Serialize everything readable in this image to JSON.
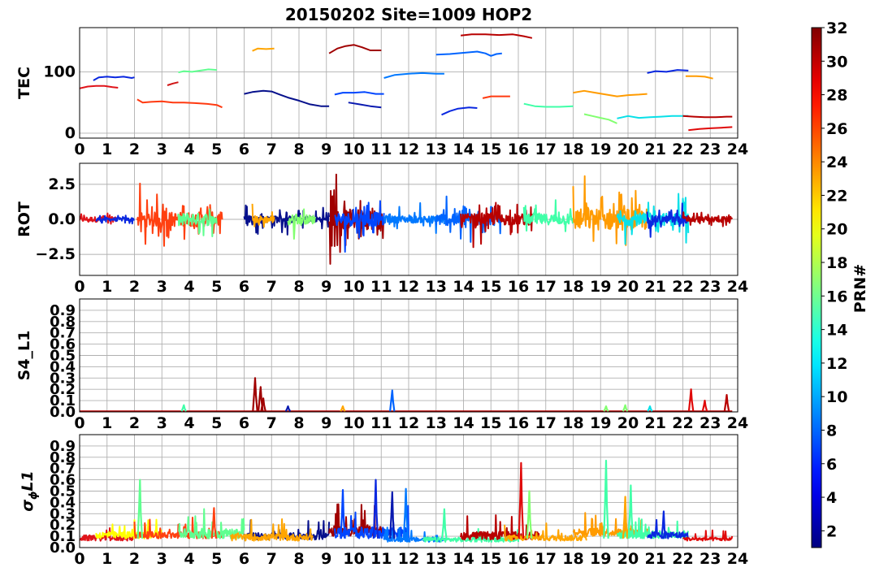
{
  "title": "20150202 Site=1009 HOP2",
  "colorbar": {
    "label": "PRN#",
    "range": [
      1,
      32
    ],
    "ticks": [
      "2",
      "4",
      "6",
      "8",
      "10",
      "12",
      "14",
      "16",
      "18",
      "20",
      "22",
      "24",
      "26",
      "28",
      "30",
      "32"
    ],
    "colormap": "jet"
  },
  "chart_data": [
    {
      "type": "line",
      "ylabel": "TEC",
      "xlim": [
        0,
        24
      ],
      "ylim": [
        -8,
        172
      ],
      "yticks": [
        0,
        100
      ],
      "ytick_labels": [
        "0",
        "100"
      ],
      "xtick_labels": [
        "0",
        "1",
        "2",
        "3",
        "4",
        "5",
        "6",
        "7",
        "8",
        "9",
        "10",
        "11",
        "12",
        "13",
        "14",
        "15",
        "16",
        "17",
        "18",
        "19",
        "20",
        "21",
        "22",
        "23",
        "24"
      ],
      "grid": true,
      "series": [
        {
          "prn": 28,
          "color": "#e0141a",
          "x": [
            0.0,
            0.3,
            0.6,
            0.9,
            1.2,
            1.4
          ],
          "y": [
            73,
            76,
            77,
            77,
            75,
            74
          ]
        },
        {
          "prn": 5,
          "color": "#0a28e0",
          "x": [
            0.5,
            0.7,
            1.0,
            1.3,
            1.6,
            1.9,
            2.0
          ],
          "y": [
            86,
            91,
            92,
            91,
            92,
            90,
            91
          ]
        },
        {
          "prn": 27,
          "color": "#ff3a10",
          "x": [
            2.1,
            2.3,
            2.6,
            3.0,
            3.4,
            3.8,
            4.2,
            4.6,
            5.0,
            5.2
          ],
          "y": [
            55,
            50,
            51,
            52,
            50,
            50,
            49,
            48,
            46,
            42
          ]
        },
        {
          "prn": 29,
          "color": "#d01414",
          "x": [
            3.2,
            3.4,
            3.6
          ],
          "y": [
            78,
            81,
            83
          ]
        },
        {
          "prn": 15,
          "color": "#60ff90",
          "x": [
            3.6,
            3.8,
            4.1,
            4.4,
            4.7,
            5.0
          ],
          "y": [
            99,
            101,
            100,
            102,
            104,
            103
          ]
        },
        {
          "prn": 23,
          "color": "#ffa500",
          "x": [
            6.3,
            6.5,
            6.8,
            7.1
          ],
          "y": [
            134,
            138,
            137,
            138
          ]
        },
        {
          "prn": 2,
          "color": "#06108c",
          "x": [
            6.0,
            6.3,
            6.7,
            7.0,
            7.3,
            7.6,
            8.0,
            8.4,
            8.8,
            9.1
          ],
          "y": [
            64,
            67,
            69,
            68,
            63,
            58,
            53,
            47,
            44,
            44
          ]
        },
        {
          "prn": 32,
          "color": "#a00000",
          "x": [
            9.1,
            9.4,
            9.7,
            10.0,
            10.3,
            10.6,
            11.0
          ],
          "y": [
            130,
            138,
            142,
            144,
            140,
            135,
            135
          ]
        },
        {
          "prn": 9,
          "color": "#0078ff",
          "x": [
            11.1,
            11.5,
            12.0,
            12.5,
            13.0,
            13.3
          ],
          "y": [
            90,
            95,
            97,
            98,
            97,
            97
          ]
        },
        {
          "prn": 8,
          "color": "#0064ff",
          "x": [
            13.0,
            13.5,
            14.0,
            14.5,
            14.8,
            15.0,
            15.2,
            15.4
          ],
          "y": [
            128,
            129,
            131,
            133,
            130,
            126,
            129,
            130
          ]
        },
        {
          "prn": 31,
          "color": "#b80000",
          "x": [
            13.9,
            14.3,
            14.8,
            15.3,
            15.8,
            16.2,
            16.5
          ],
          "y": [
            159,
            161,
            161,
            160,
            161,
            158,
            155
          ]
        },
        {
          "prn": 6,
          "color": "#0046ff",
          "x": [
            9.3,
            9.6,
            10.0,
            10.4,
            10.8,
            11.1
          ],
          "y": [
            63,
            66,
            66,
            67,
            64,
            64
          ]
        },
        {
          "prn": 3,
          "color": "#0a1ab0",
          "x": [
            9.8,
            10.2,
            10.6,
            11.0
          ],
          "y": [
            50,
            47,
            44,
            42
          ]
        },
        {
          "prn": 5,
          "color": "#0a28e0",
          "x": [
            13.2,
            13.5,
            13.8,
            14.2,
            14.5
          ],
          "y": [
            30,
            36,
            40,
            42,
            41
          ]
        },
        {
          "prn": 27,
          "color": "#ff3a10",
          "x": [
            14.7,
            15.0,
            15.3,
            15.7
          ],
          "y": [
            57,
            60,
            60,
            60
          ]
        },
        {
          "prn": 14,
          "color": "#40ffa8",
          "x": [
            16.2,
            16.6,
            17.0,
            17.5,
            18.0
          ],
          "y": [
            48,
            44,
            43,
            43,
            44
          ]
        },
        {
          "prn": 24,
          "color": "#ff9b00",
          "x": [
            18.0,
            18.4,
            18.8,
            19.2,
            19.6,
            20.0,
            20.4,
            20.7
          ],
          "y": [
            66,
            69,
            66,
            63,
            60,
            62,
            63,
            64
          ]
        },
        {
          "prn": 16,
          "color": "#82ff70",
          "x": [
            18.4,
            18.7,
            19.0,
            19.3,
            19.6
          ],
          "y": [
            31,
            28,
            25,
            22,
            16
          ]
        },
        {
          "prn": 12,
          "color": "#08e0e8",
          "x": [
            19.6,
            20.0,
            20.4,
            20.8,
            21.2,
            21.6,
            22.2
          ],
          "y": [
            24,
            28,
            25,
            26,
            27,
            28,
            28
          ]
        },
        {
          "prn": 5,
          "color": "#0a28e0",
          "x": [
            20.7,
            21.0,
            21.4,
            21.8,
            22.2
          ],
          "y": [
            98,
            101,
            100,
            103,
            102
          ]
        },
        {
          "prn": 24,
          "color": "#ff9b00",
          "x": [
            22.1,
            22.5,
            22.8,
            23.1
          ],
          "y": [
            93,
            93,
            92,
            89
          ]
        },
        {
          "prn": 31,
          "color": "#b80000",
          "x": [
            22.0,
            22.4,
            22.8,
            23.2,
            23.6,
            23.8
          ],
          "y": [
            28,
            27,
            26,
            26,
            27,
            27
          ]
        },
        {
          "prn": 30,
          "color": "#e00a0a",
          "x": [
            22.2,
            22.6,
            23.0,
            23.4,
            23.8
          ],
          "y": [
            5,
            7,
            8,
            9,
            10
          ]
        }
      ]
    },
    {
      "type": "line",
      "ylabel": "ROT",
      "xlim": [
        0,
        24
      ],
      "ylim": [
        -4.0,
        4.0
      ],
      "yticks": [
        -2.5,
        0.0,
        2.5
      ],
      "ytick_labels": [
        "−2.5",
        "0.0",
        "2.5"
      ],
      "xtick_labels": [
        "0",
        "1",
        "2",
        "3",
        "4",
        "5",
        "6",
        "7",
        "8",
        "9",
        "10",
        "11",
        "12",
        "13",
        "14",
        "15",
        "16",
        "17",
        "18",
        "19",
        "20",
        "21",
        "22",
        "23",
        "24"
      ],
      "grid": true,
      "noise_segments": [
        {
          "start": 0.0,
          "end": 1.4,
          "color": "#e0141a",
          "amp": 0.9
        },
        {
          "start": 0.6,
          "end": 2.0,
          "color": "#0a28e0",
          "amp": 0.6
        },
        {
          "start": 2.1,
          "end": 5.2,
          "color": "#ff4010",
          "amp": 2.6
        },
        {
          "start": 3.6,
          "end": 5.0,
          "color": "#60ff90",
          "amp": 2.2
        },
        {
          "start": 6.0,
          "end": 9.1,
          "color": "#06108c",
          "amp": 1.2
        },
        {
          "start": 6.3,
          "end": 7.1,
          "color": "#ffa500",
          "amp": 1.3
        },
        {
          "start": 7.6,
          "end": 8.6,
          "color": "#82ff70",
          "amp": 1.6
        },
        {
          "start": 9.1,
          "end": 11.1,
          "color": "#a00000",
          "amp": 3.6
        },
        {
          "start": 9.3,
          "end": 11.1,
          "color": "#0046ff",
          "amp": 2.4
        },
        {
          "start": 11.1,
          "end": 13.3,
          "color": "#0078ff",
          "amp": 1.2
        },
        {
          "start": 13.0,
          "end": 15.4,
          "color": "#0064ff",
          "amp": 2.2
        },
        {
          "start": 13.9,
          "end": 16.5,
          "color": "#b80000",
          "amp": 2.0
        },
        {
          "start": 16.2,
          "end": 18.0,
          "color": "#40ffa8",
          "amp": 1.9
        },
        {
          "start": 18.0,
          "end": 20.7,
          "color": "#ff9b00",
          "amp": 3.8
        },
        {
          "start": 19.6,
          "end": 22.2,
          "color": "#08e0e8",
          "amp": 2.2
        },
        {
          "start": 20.7,
          "end": 22.2,
          "color": "#0a28e0",
          "amp": 1.3
        },
        {
          "start": 22.0,
          "end": 23.8,
          "color": "#b80000",
          "amp": 1.0
        }
      ]
    },
    {
      "type": "line",
      "ylabel": "S4_L1",
      "xlim": [
        0,
        24
      ],
      "ylim": [
        0.0,
        1.0
      ],
      "yticks": [
        0.0,
        0.1,
        0.2,
        0.3,
        0.4,
        0.5,
        0.6,
        0.7,
        0.8,
        0.9
      ],
      "ytick_labels": [
        "0.0",
        "0.1",
        "0.2",
        "0.3",
        "0.4",
        "0.5",
        "0.6",
        "0.7",
        "0.8",
        "0.9"
      ],
      "xtick_labels": [
        "0",
        "1",
        "2",
        "3",
        "4",
        "5",
        "6",
        "7",
        "8",
        "9",
        "10",
        "11",
        "12",
        "13",
        "14",
        "15",
        "16",
        "17",
        "18",
        "19",
        "20",
        "21",
        "22",
        "23",
        "24"
      ],
      "grid": true,
      "baseline_color": "#b80000",
      "spikes": [
        {
          "x": 6.4,
          "peak": 0.3,
          "color": "#a00000"
        },
        {
          "x": 6.6,
          "peak": 0.22,
          "color": "#a00000"
        },
        {
          "x": 6.7,
          "peak": 0.12,
          "color": "#a00000"
        },
        {
          "x": 3.8,
          "peak": 0.06,
          "color": "#40ffa8"
        },
        {
          "x": 7.6,
          "peak": 0.05,
          "color": "#0a1ab0"
        },
        {
          "x": 9.6,
          "peak": 0.05,
          "color": "#ffa500"
        },
        {
          "x": 11.4,
          "peak": 0.19,
          "color": "#0064ff"
        },
        {
          "x": 19.2,
          "peak": 0.05,
          "color": "#82ff70"
        },
        {
          "x": 19.9,
          "peak": 0.06,
          "color": "#82ff70"
        },
        {
          "x": 20.8,
          "peak": 0.05,
          "color": "#08e0e8"
        },
        {
          "x": 22.3,
          "peak": 0.2,
          "color": "#e00a0a"
        },
        {
          "x": 22.8,
          "peak": 0.1,
          "color": "#e00a0a"
        },
        {
          "x": 23.6,
          "peak": 0.15,
          "color": "#b80000"
        }
      ]
    },
    {
      "type": "line",
      "ylabel": "σφL1",
      "ylabel_base": "σ",
      "ylabel_sub": "ϕ",
      "ylabel_rest": "L1",
      "xlim": [
        0,
        24
      ],
      "ylim": [
        0.0,
        1.0
      ],
      "yticks": [
        0.0,
        0.1,
        0.2,
        0.3,
        0.4,
        0.5,
        0.6,
        0.7,
        0.8,
        0.9
      ],
      "ytick_labels": [
        "0.0",
        "0.1",
        "0.2",
        "0.3",
        "0.4",
        "0.5",
        "0.6",
        "0.7",
        "0.8",
        "0.9"
      ],
      "xtick_labels": [
        "0",
        "1",
        "2",
        "3",
        "4",
        "5",
        "6",
        "7",
        "8",
        "9",
        "10",
        "11",
        "12",
        "13",
        "14",
        "15",
        "16",
        "17",
        "18",
        "19",
        "20",
        "21",
        "22",
        "23",
        "24"
      ],
      "grid": true,
      "noise_segments": [
        {
          "start": 0.0,
          "end": 2.0,
          "color": "#e0141a",
          "base": 0.06,
          "amp": 0.1
        },
        {
          "start": 0.6,
          "end": 3.0,
          "color": "#ffff00",
          "base": 0.08,
          "amp": 0.12
        },
        {
          "start": 2.0,
          "end": 5.2,
          "color": "#ff4010",
          "base": 0.08,
          "amp": 0.12
        },
        {
          "start": 3.6,
          "end": 6.0,
          "color": "#60ff90",
          "base": 0.08,
          "amp": 0.18
        },
        {
          "start": 6.0,
          "end": 9.1,
          "color": "#06108c",
          "base": 0.07,
          "amp": 0.12
        },
        {
          "start": 5.5,
          "end": 8.5,
          "color": "#ffa500",
          "base": 0.06,
          "amp": 0.12
        },
        {
          "start": 9.1,
          "end": 11.1,
          "color": "#a00000",
          "base": 0.1,
          "amp": 0.18
        },
        {
          "start": 9.3,
          "end": 12.0,
          "color": "#0046ff",
          "base": 0.08,
          "amp": 0.2
        },
        {
          "start": 11.1,
          "end": 13.3,
          "color": "#0078ff",
          "base": 0.05,
          "amp": 0.08
        },
        {
          "start": 12.5,
          "end": 16.0,
          "color": "#40ffa8",
          "base": 0.05,
          "amp": 0.08
        },
        {
          "start": 13.9,
          "end": 16.8,
          "color": "#b80000",
          "base": 0.07,
          "amp": 0.14
        },
        {
          "start": 15.5,
          "end": 18.5,
          "color": "#ffa500",
          "base": 0.06,
          "amp": 0.1
        },
        {
          "start": 18.0,
          "end": 20.7,
          "color": "#ff9b00",
          "base": 0.1,
          "amp": 0.14
        },
        {
          "start": 19.6,
          "end": 22.2,
          "color": "#40ffa8",
          "base": 0.08,
          "amp": 0.14
        },
        {
          "start": 20.7,
          "end": 22.2,
          "color": "#0a28e0",
          "base": 0.08,
          "amp": 0.12
        },
        {
          "start": 22.0,
          "end": 23.8,
          "color": "#e00a0a",
          "base": 0.06,
          "amp": 0.06
        }
      ],
      "spikes": [
        {
          "x": 2.2,
          "peak": 0.6,
          "color": "#60ff90"
        },
        {
          "x": 4.9,
          "peak": 0.35,
          "color": "#ff4010"
        },
        {
          "x": 9.6,
          "peak": 0.51,
          "color": "#0046ff"
        },
        {
          "x": 10.8,
          "peak": 0.6,
          "color": "#0a28e0"
        },
        {
          "x": 11.4,
          "peak": 0.49,
          "color": "#0a1ab0"
        },
        {
          "x": 11.9,
          "peak": 0.52,
          "color": "#0078ff"
        },
        {
          "x": 13.3,
          "peak": 0.34,
          "color": "#40ffa8"
        },
        {
          "x": 16.1,
          "peak": 0.75,
          "color": "#e00a0a"
        },
        {
          "x": 16.4,
          "peak": 0.5,
          "color": "#82ff70"
        },
        {
          "x": 19.2,
          "peak": 0.77,
          "color": "#40ffa8"
        },
        {
          "x": 19.9,
          "peak": 0.45,
          "color": "#ffa500"
        },
        {
          "x": 20.1,
          "peak": 0.55,
          "color": "#40ffa8"
        },
        {
          "x": 21.3,
          "peak": 0.32,
          "color": "#0a28e0"
        }
      ]
    }
  ]
}
